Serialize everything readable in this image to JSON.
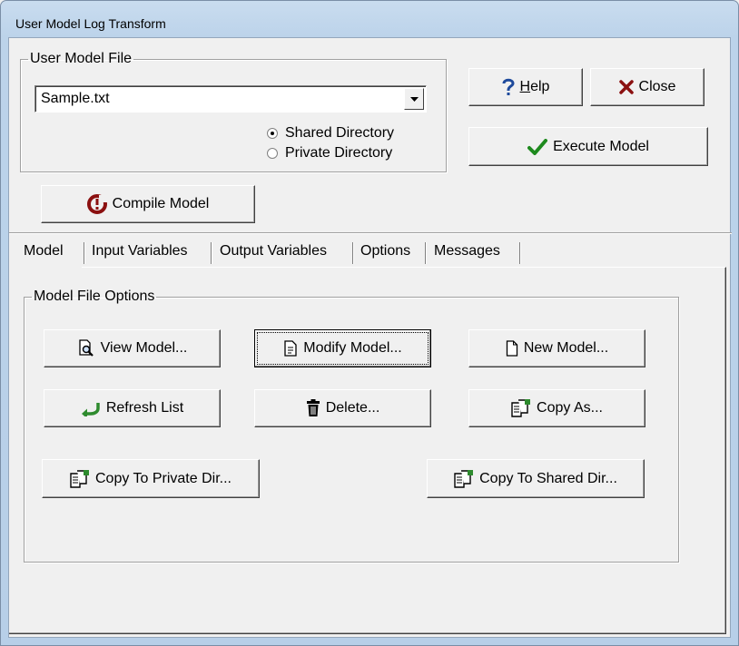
{
  "window": {
    "title": "User Model Log Transform"
  },
  "model_file_group": {
    "legend": "User Model File",
    "selected_file": "Sample.txt",
    "radio_shared": {
      "label": "Shared Directory",
      "checked": true
    },
    "radio_private": {
      "label": "Private Directory",
      "checked": false
    }
  },
  "buttons": {
    "help": {
      "label_u": "H",
      "label_rest": "elp",
      "icon": "question-icon"
    },
    "close": {
      "label": "Close",
      "icon": "x-icon"
    },
    "execute": {
      "label": "Execute Model",
      "icon": "checkmark-icon"
    },
    "compile": {
      "label": "Compile Model",
      "icon": "compile-icon"
    }
  },
  "tabs": [
    {
      "label": "Model",
      "active": true
    },
    {
      "label": "Input Variables",
      "active": false
    },
    {
      "label": "Output Variables",
      "active": false
    },
    {
      "label": "Options",
      "active": false
    },
    {
      "label": "Messages",
      "active": false
    }
  ],
  "model_options": {
    "legend": "Model File Options",
    "view": "View Model...",
    "modify": "Modify Model...",
    "new": "New Model...",
    "refresh": "Refresh List",
    "delete": "Delete...",
    "copy_as": "Copy As...",
    "copy_private": "Copy To Private Dir...",
    "copy_shared": "Copy To Shared Dir..."
  },
  "colors": {
    "title_bar": "#bcd3ea",
    "face": "#f0f0f0",
    "execute_check": "#1e8a1e",
    "close_x": "#8b1010",
    "help_q": "#1e4a9c",
    "refresh_arrow": "#2e8b2e"
  }
}
